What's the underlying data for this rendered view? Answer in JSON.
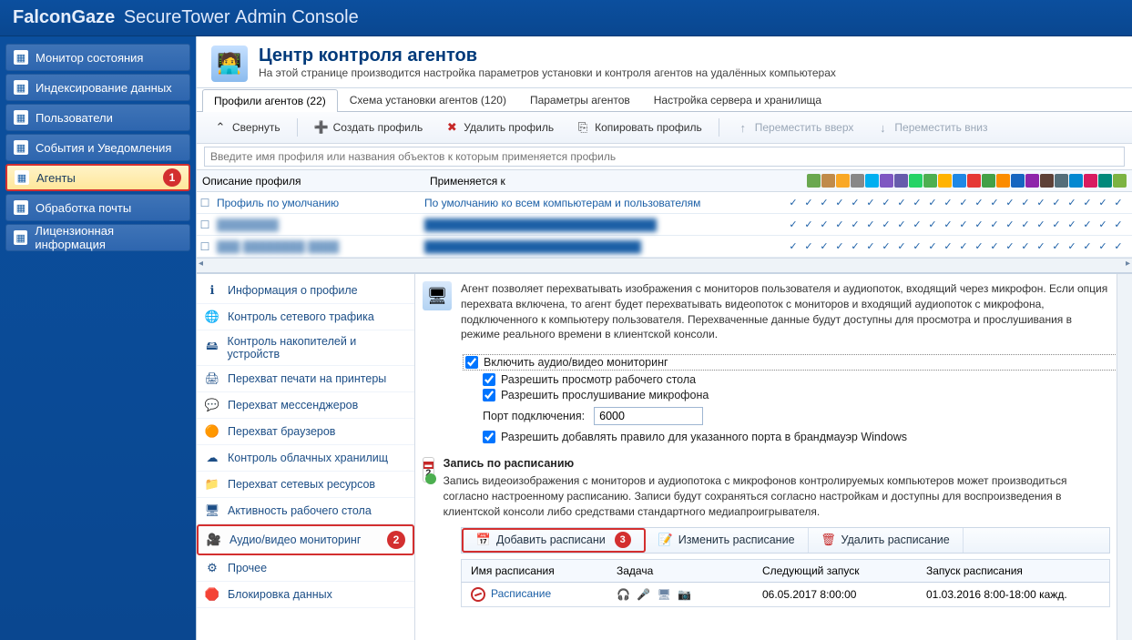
{
  "title": {
    "brand": "FalconGaze",
    "product": "SecureTower",
    "rest": "Admin Console"
  },
  "sidebar": {
    "items": [
      {
        "label": "Монитор состояния",
        "name": "monitor-status"
      },
      {
        "label": "Индексирование данных",
        "name": "data-indexing"
      },
      {
        "label": "Пользователи",
        "name": "users"
      },
      {
        "label": "События и Уведомления",
        "name": "events-notifications"
      },
      {
        "label": "Агенты",
        "name": "agents",
        "selected": true,
        "badge": "1"
      },
      {
        "label": "Обработка почты",
        "name": "mail-processing"
      },
      {
        "label": "Лицензионная информация",
        "name": "license-info"
      }
    ]
  },
  "header": {
    "title": "Центр контроля агентов",
    "subtitle": "На этой странице производится настройка параметров установки и контроля агентов на удалённых компьютерах"
  },
  "tabs": [
    {
      "label": "Профили агентов (22)",
      "active": true
    },
    {
      "label": "Схема установки агентов (120)"
    },
    {
      "label": "Параметры агентов"
    },
    {
      "label": "Настройка сервера и хранилища"
    }
  ],
  "toolbar": {
    "collapse": "Свернуть",
    "create": "Создать профиль",
    "delete": "Удалить профиль",
    "copy": "Копировать профиль",
    "moveUp": "Переместить вверх",
    "moveDown": "Переместить вниз"
  },
  "search": {
    "placeholder": "Введите имя профиля или названия объектов к которым применяется профиль"
  },
  "grid": {
    "col1": "Описание профиля",
    "col2": "Применяется к",
    "rows": [
      {
        "desc": "Профиль по умолчанию",
        "apply": "По умолчанию ко всем компьютерам и пользователям"
      },
      {
        "desc": "████████",
        "apply": "██████████████████████████████",
        "blur": true
      },
      {
        "desc": "███ ████████ ████",
        "apply": "████████████████████████████",
        "blur": true
      }
    ]
  },
  "categories": [
    {
      "label": "Информация о профиле",
      "icon": "ℹ"
    },
    {
      "label": "Контроль сетевого трафика",
      "icon": "🌐"
    },
    {
      "label": "Контроль накопителей и устройств",
      "icon": "🖴"
    },
    {
      "label": "Перехват печати на принтеры",
      "icon": "🖨"
    },
    {
      "label": "Перехват мессенджеров",
      "icon": "💬"
    },
    {
      "label": "Перехват браузеров",
      "icon": "🟠"
    },
    {
      "label": "Контроль облачных хранилищ",
      "icon": "☁"
    },
    {
      "label": "Перехват сетевых ресурсов",
      "icon": "📁"
    },
    {
      "label": "Активность рабочего стола",
      "icon": "🖥"
    },
    {
      "label": "Аудио/видео мониторинг",
      "icon": "🎥",
      "selected": true,
      "badge": "2"
    },
    {
      "label": "Прочее",
      "icon": "⚙"
    },
    {
      "label": "Блокировка данных",
      "icon": "🛑"
    }
  ],
  "details": {
    "desc": "Агент позволяет перехватывать изображения с мониторов пользователя и аудиопоток, входящий через микрофон. Если опция перехвата включена, то агент будет перехватывать видеопоток с мониторов и входящий аудиопоток с микрофона, подключенного к компьютеру пользователя. Перехваченные данные будут доступны для просмотра и прослушивания в режиме реального времени в клиентской консоли.",
    "enable": "Включить аудио/видео мониторинг",
    "allowDesktop": "Разрешить просмотр рабочего стола",
    "allowMic": "Разрешить прослушивание микрофона",
    "portLabel": "Порт подключения:",
    "portValue": "6000",
    "firewall": "Разрешить добавлять правило для указанного порта в брандмауэр Windows",
    "schedTitle": "Запись по расписанию",
    "schedDesc": "Запись видеоизображения с мониторов и аудиопотока с микрофонов контролируемых компьютеров может производиться согласно настроенному расписанию. Записи будут сохраняться согласно настройкам и доступны для воспроизведения в клиентской консоли либо средствами стандартного медиапроигрывателя.",
    "addSched": "Добавить расписани",
    "addBadge": "3",
    "editSched": "Изменить расписание",
    "delSched": "Удалить расписание",
    "stHead": {
      "c1": "Имя расписания",
      "c2": "Задача",
      "c3": "Следующий запуск",
      "c4": "Запуск расписания"
    },
    "stRow": {
      "c1": "Расписание",
      "c3": "06.05.2017 8:00:00",
      "c4": "01.03.2016 8:00-18:00 кажд."
    }
  }
}
